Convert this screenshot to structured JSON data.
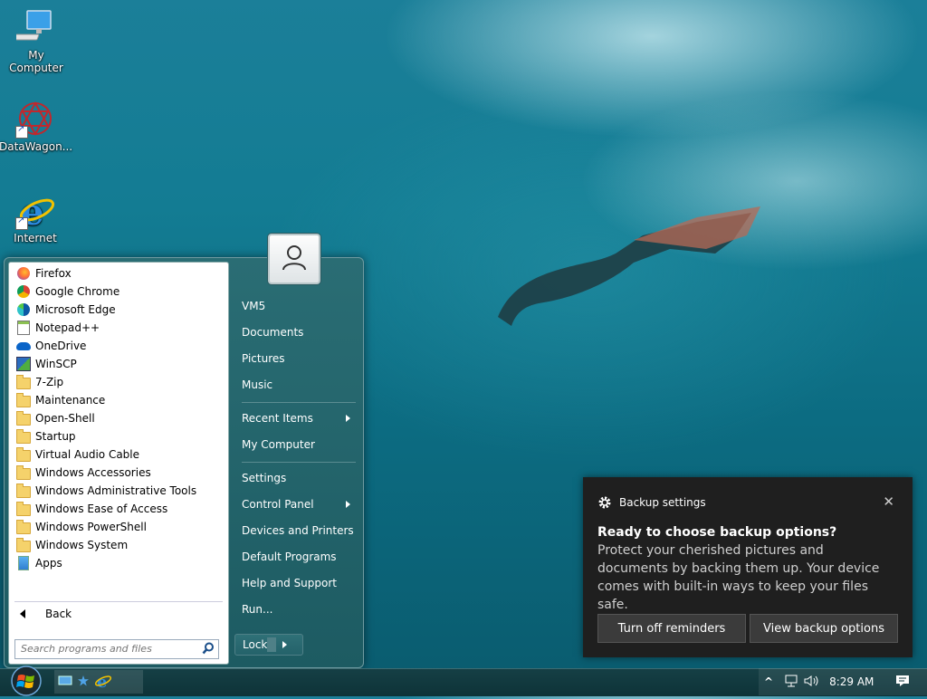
{
  "desktop": {
    "icons": [
      {
        "label": "My Computer",
        "icon": "computer-icon"
      },
      {
        "label": "DataWagon...",
        "icon": "datawagon-icon"
      },
      {
        "label": "Internet",
        "icon": "internet-explorer-icon"
      }
    ]
  },
  "start_menu": {
    "programs": [
      {
        "label": "Firefox",
        "icon": "firefox-icon"
      },
      {
        "label": "Google Chrome",
        "icon": "chrome-icon"
      },
      {
        "label": "Microsoft Edge",
        "icon": "edge-icon"
      },
      {
        "label": "Notepad++",
        "icon": "notepadpp-icon"
      },
      {
        "label": "OneDrive",
        "icon": "onedrive-icon"
      },
      {
        "label": "WinSCP",
        "icon": "winscp-icon"
      },
      {
        "label": "7-Zip",
        "icon": "folder-icon"
      },
      {
        "label": "Maintenance",
        "icon": "folder-icon"
      },
      {
        "label": "Open-Shell",
        "icon": "folder-icon"
      },
      {
        "label": "Startup",
        "icon": "folder-icon"
      },
      {
        "label": "Virtual Audio Cable",
        "icon": "folder-icon"
      },
      {
        "label": "Windows Accessories",
        "icon": "folder-icon"
      },
      {
        "label": "Windows Administrative Tools",
        "icon": "folder-icon"
      },
      {
        "label": "Windows Ease of Access",
        "icon": "folder-icon"
      },
      {
        "label": "Windows PowerShell",
        "icon": "folder-icon"
      },
      {
        "label": "Windows System",
        "icon": "folder-icon"
      },
      {
        "label": "Apps",
        "icon": "apps-icon"
      }
    ],
    "back_label": "Back",
    "search_placeholder": "Search programs and files",
    "places": [
      {
        "label": "VM5"
      },
      {
        "label": "Documents"
      },
      {
        "label": "Pictures"
      },
      {
        "label": "Music"
      },
      {
        "label": "Recent Items"
      },
      {
        "label": "My Computer"
      },
      {
        "label": "Settings"
      },
      {
        "label": "Control Panel"
      },
      {
        "label": "Devices and Printers"
      },
      {
        "label": "Default Programs"
      },
      {
        "label": "Help and Support"
      },
      {
        "label": "Run..."
      }
    ],
    "lock_label": "Lock"
  },
  "notification": {
    "app": "Backup settings",
    "close_glyph": "✕",
    "title": "Ready to choose backup options?",
    "body": "Protect your cherished pictures and documents by backing them up. Your device comes with built-in ways to keep your files safe.",
    "button_1": "Turn off reminders",
    "button_2": "View backup options"
  },
  "taskbar": {
    "clock": "8:29 AM",
    "chevron_glyph": "^"
  }
}
